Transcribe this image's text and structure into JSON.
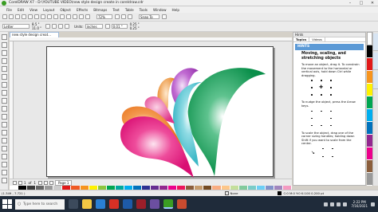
{
  "window": {
    "title": "CorelDRAW X7 - D:\\YOUTUBE VIDEO\\new style design create in coreldraw.cdr",
    "minimize": "–",
    "maximize": "□",
    "close": "✕"
  },
  "menu": [
    "File",
    "Edit",
    "View",
    "Layout",
    "Object",
    "Effects",
    "Bitmaps",
    "Text",
    "Table",
    "Tools",
    "Window",
    "Help"
  ],
  "toolbar1": {
    "zoom": "72%",
    "snap_to": "Snap To"
  },
  "toolbar2": {
    "page_size": "Letter",
    "width": "8.5 \"",
    "height": "11.0 \"",
    "units_label": "Units:",
    "units": "inches",
    "nudge": "0.01 \"",
    "dup_x": "0.25 \"",
    "dup_y": "0.25 \""
  },
  "document_tab": "new style design creat...",
  "page_nav": {
    "current": "1",
    "of_label": "of",
    "total": "1",
    "page_tab": "Page 1"
  },
  "status": {
    "coords": "(1.349 , 7.721 )",
    "fill_none": "None",
    "color_mode": "C:0 M:0 Y:0 K:100  0.200 pt"
  },
  "docker": {
    "header": "Hints",
    "tabs": [
      "Topics",
      "Videos"
    ],
    "hints_label": "HINTS",
    "title": "Moving, scaling, and stretching objects",
    "paragraphs": [
      "To move an object, drag it. To constrain the movement to the horizontal or vertical axis, hold down Ctrl while dragging.",
      "To nudge the object, press the Arrow keys.",
      "To scale the object, drag one of the corner sizing handles; holding down Shift if you want to scale from the center."
    ]
  },
  "taskbar": {
    "search_placeholder": "Type here to search",
    "time": "2:22 PM",
    "date": "7/16/2021"
  },
  "colors": {
    "pink": "#e8137a",
    "orange": "#ee7d21",
    "cyan": "#55c7d3",
    "green": "#0e9a52",
    "purple": "#b44fc7",
    "light_pink": "#f2a7c9",
    "accent_blue": "#5c9ad6"
  }
}
